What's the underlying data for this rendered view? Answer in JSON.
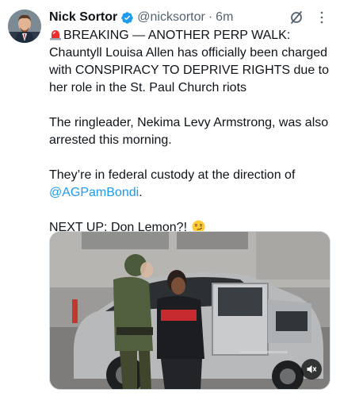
{
  "tweet": {
    "author": {
      "display_name": "Nick Sortor",
      "handle": "@nicksortor",
      "verified": true
    },
    "separator": "·",
    "timestamp": "6m",
    "paragraphs": {
      "p1_text": "BREAKING — ANOTHER PERP WALK: Chauntyll Louisa Allen has officially been charged with CONSPIRACY TO DEPRIVE RIGHTS due to her role in the St. Paul Church riots",
      "p2_text": "The ringleader, Nekima Levy Armstrong, was also arrested this morning.",
      "p3_prefix": "They’re in federal custody at the direction of ",
      "p3_mention": "@AGPamBondi",
      "p3_suffix": ".",
      "p4_text": "NEXT UP: Don Lemon?!"
    },
    "icons": {
      "siren": "rotating-light-emoji",
      "smirk": "smirking-face-emoji",
      "grok": "grok-icon",
      "more": "more-icon",
      "mute": "muted-speaker-icon"
    },
    "media": {
      "type": "video",
      "muted": true
    },
    "colors": {
      "link": "#1d9bf0",
      "verified": "#1d9bf0",
      "secondary_text": "#536471",
      "primary_text": "#0f1419"
    }
  }
}
